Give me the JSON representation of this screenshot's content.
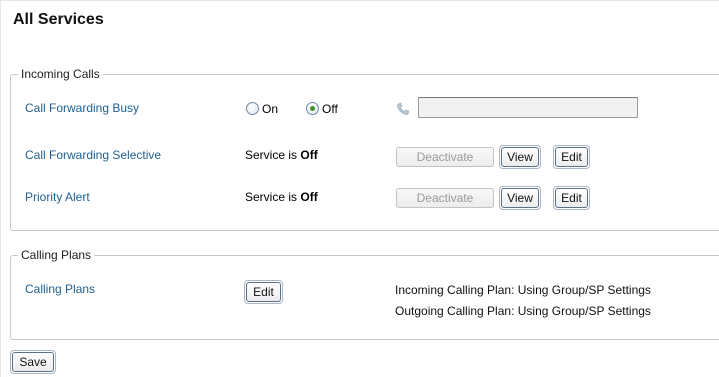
{
  "page": {
    "title": "All Services"
  },
  "incoming": {
    "legend": "Incoming Calls",
    "forwarding_busy": {
      "label": "Call Forwarding Busy",
      "on_label": "On",
      "off_label": "Off",
      "selected": "Off",
      "number_value": "",
      "phone_icon": "phone-icon"
    },
    "forwarding_selective": {
      "label": "Call Forwarding Selective",
      "status_prefix": "Service is",
      "status_value": "Off",
      "deactivate_label": "Deactivate",
      "view_label": "View",
      "edit_label": "Edit"
    },
    "priority_alert": {
      "label": "Priority Alert",
      "status_prefix": "Service is",
      "status_value": "Off",
      "deactivate_label": "Deactivate",
      "view_label": "View",
      "edit_label": "Edit"
    }
  },
  "plans": {
    "legend": "Calling Plans",
    "label": "Calling Plans",
    "edit_label": "Edit",
    "incoming_text": "Incoming Calling Plan: Using Group/SP Settings",
    "outgoing_text": "Outgoing Calling Plan: Using Group/SP Settings"
  },
  "footer": {
    "save_label": "Save"
  },
  "colors": {
    "link": "#1f5f8e",
    "radio_checked": "#3f8f2a",
    "border": "#c8c8c8"
  }
}
